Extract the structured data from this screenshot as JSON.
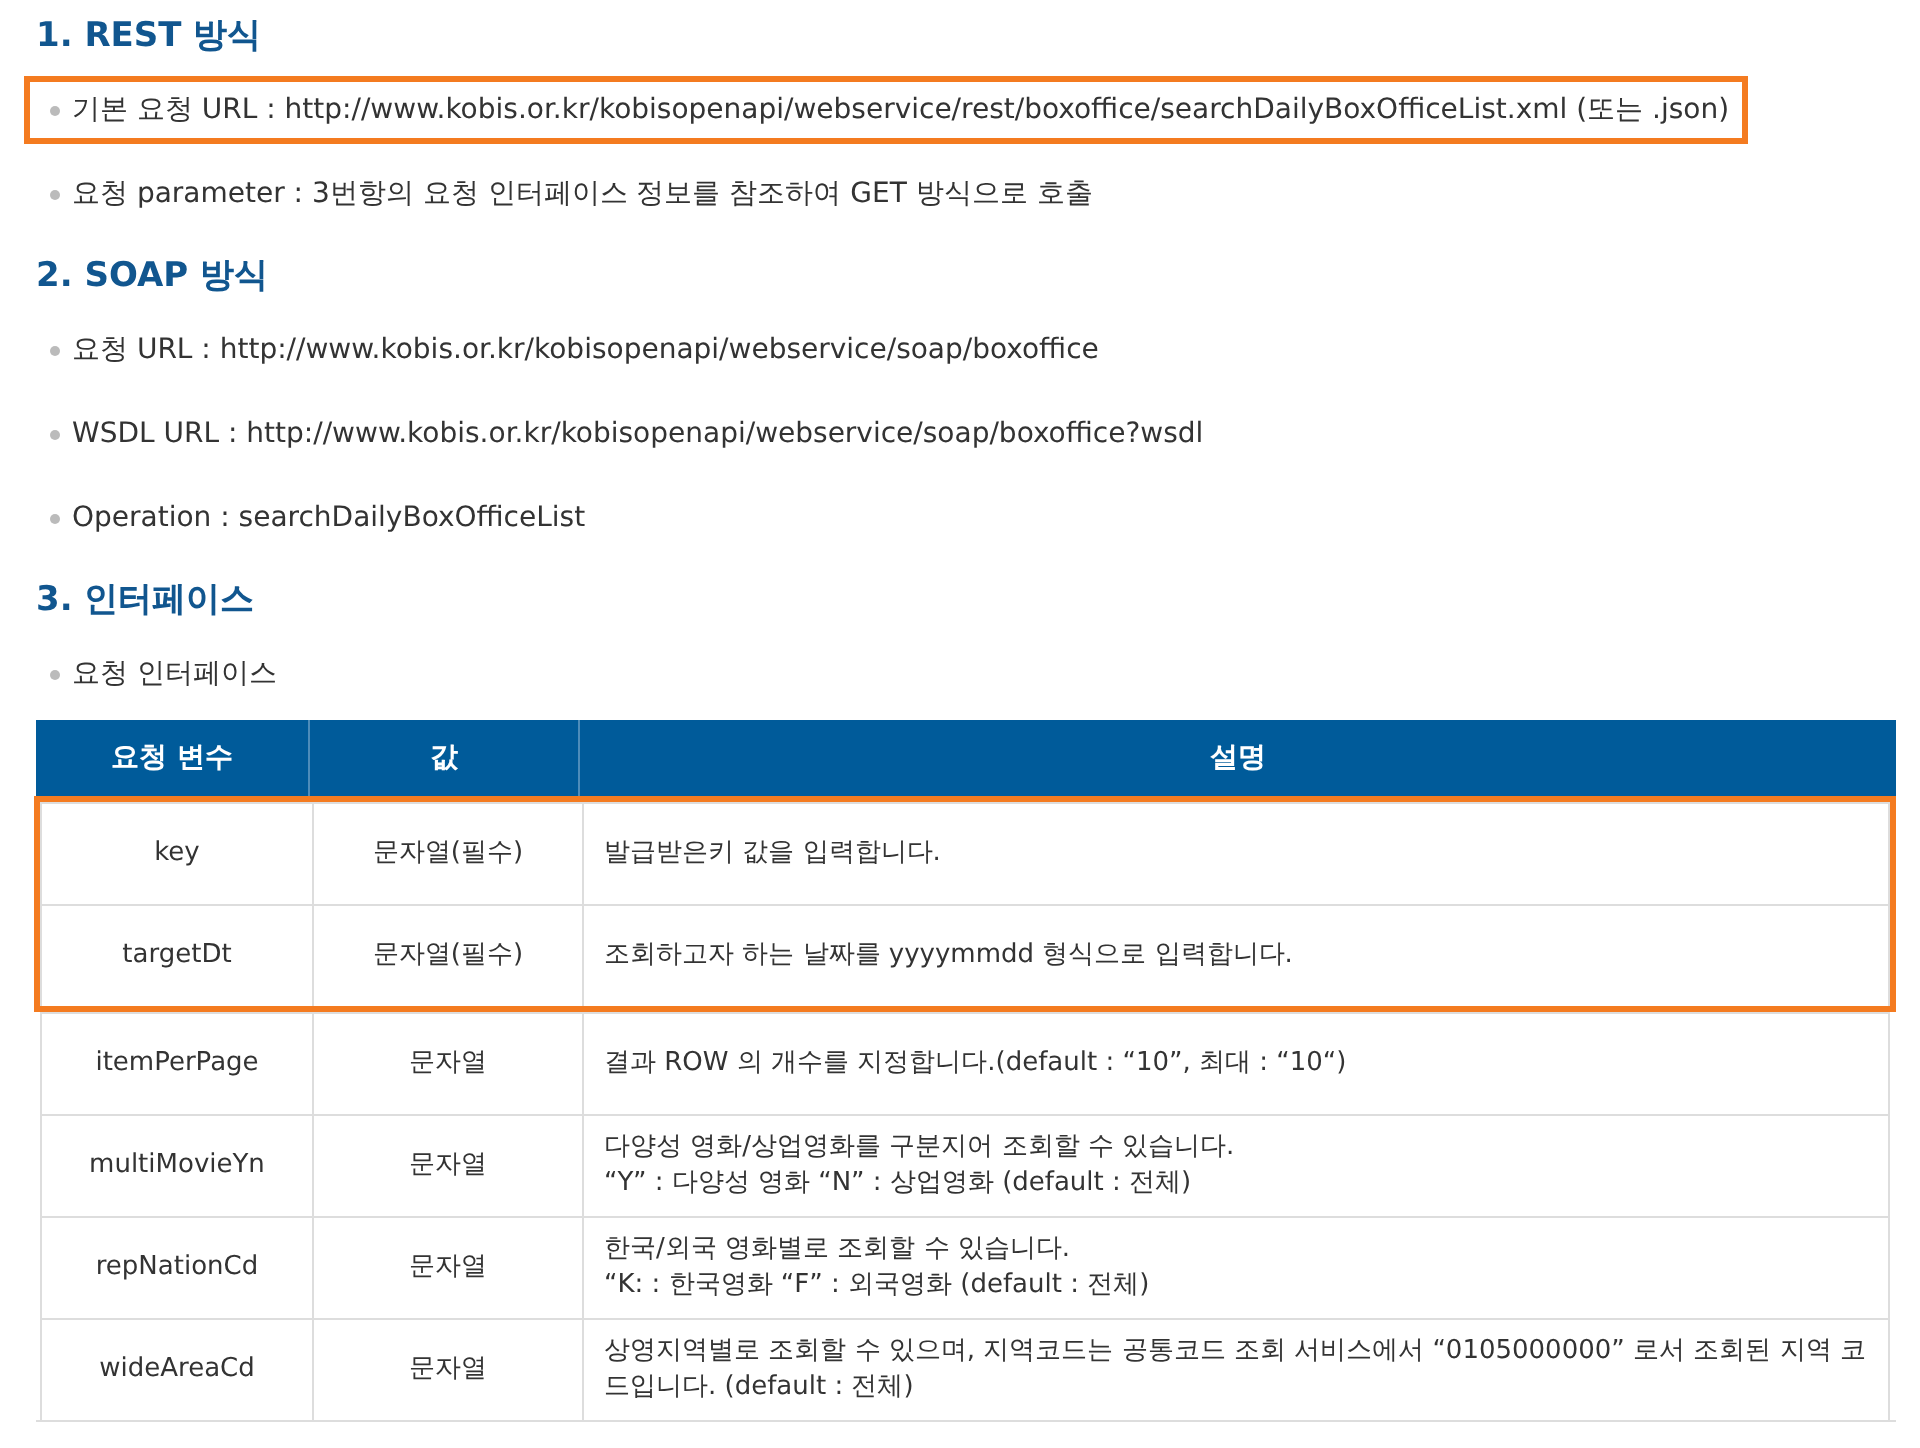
{
  "sections": [
    {
      "heading": "1. REST 방식",
      "bullets": [
        {
          "text": "기본 요청 URL : http://www.kobis.or.kr/kobisopenapi/webservice/rest/boxoffice/searchDailyBoxOfficeList.xml (또는 .json)",
          "highlighted": true
        },
        {
          "text": "요청 parameter : 3번항의 요청 인터페이스 정보를 참조하여 GET 방식으로 호출",
          "highlighted": false
        }
      ]
    },
    {
      "heading": "2. SOAP 방식",
      "bullets": [
        {
          "text": "요청 URL : http://www.kobis.or.kr/kobisopenapi/webservice/soap/boxoffice",
          "highlighted": false
        },
        {
          "text": "WSDL URL : http://www.kobis.or.kr/kobisopenapi/webservice/soap/boxoffice?wsdl",
          "highlighted": false
        },
        {
          "text": "Operation : searchDailyBoxOfficeList",
          "highlighted": false
        }
      ]
    },
    {
      "heading": "3. 인터페이스",
      "bullets": [
        {
          "text": "요청 인터페이스",
          "highlighted": false
        }
      ],
      "table": {
        "columns": [
          "요청 변수",
          "값",
          "설명"
        ],
        "rows": [
          {
            "variable": "key",
            "value": "문자열(필수)",
            "description": "발급받은키 값을 입력합니다.",
            "highlighted": true
          },
          {
            "variable": "targetDt",
            "value": "문자열(필수)",
            "description": "조회하고자 하는 날짜를 yyyymmdd 형식으로 입력합니다.",
            "highlighted": true
          },
          {
            "variable": "itemPerPage",
            "value": "문자열",
            "description": "결과 ROW 의 개수를 지정합니다.(default : “10”, 최대 : “10“)",
            "highlighted": false
          },
          {
            "variable": "multiMovieYn",
            "value": "문자열",
            "description": "다양성 영화/상업영화를 구분지어 조회할 수 있습니다.\n“Y” : 다양성 영화 “N” : 상업영화 (default : 전체)",
            "highlighted": false
          },
          {
            "variable": "repNationCd",
            "value": "문자열",
            "description": "한국/외국 영화별로 조회할 수 있습니다.\n“K: : 한국영화 “F” : 외국영화 (default : 전체)",
            "highlighted": false
          },
          {
            "variable": "wideAreaCd",
            "value": "문자열",
            "description": "상영지역별로 조회할 수 있으며, 지역코드는 공통코드 조회 서비스에서 “0105000000” 로서 조회된 지역 코드입니다. (default : 전체)",
            "highlighted": false
          }
        ]
      }
    }
  ]
}
